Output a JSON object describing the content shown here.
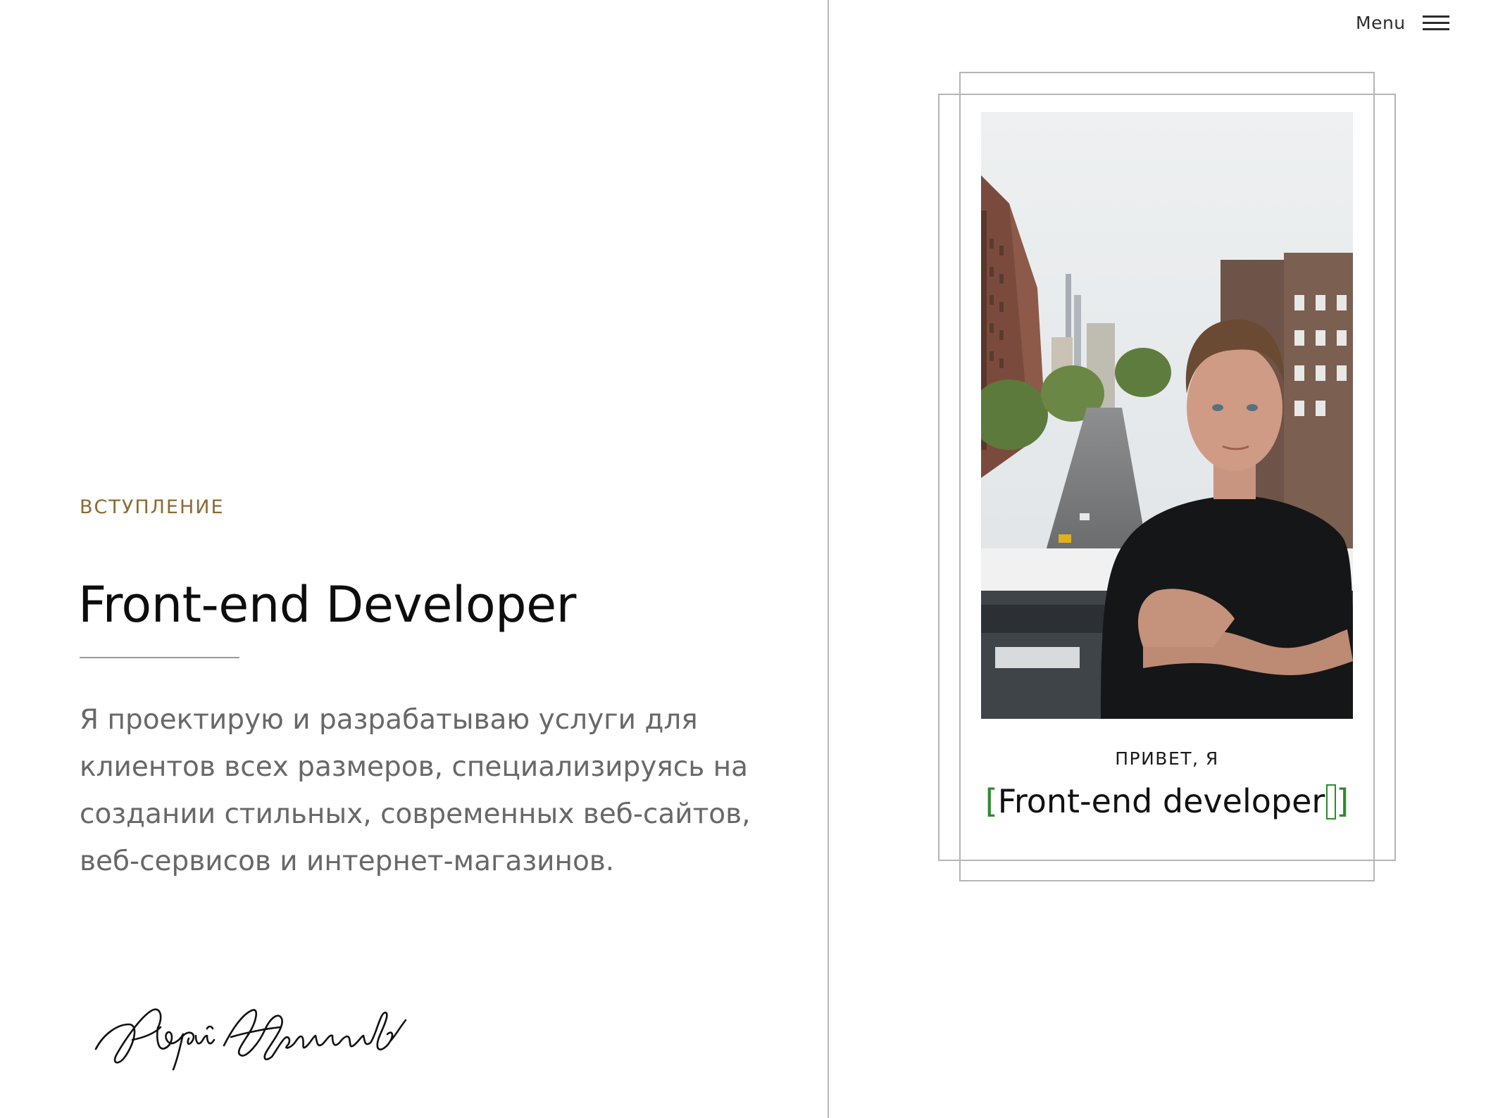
{
  "header": {
    "menu_label": "Menu"
  },
  "intro": {
    "eyebrow": "ВСТУПЛЕНИЕ",
    "title": "Front-end Developer",
    "description": "Я проектирую и разрабатываю услуги для клиентов всех размеров, специализируясь на создании стильных, современных веб-сайтов, веб-сервисов и интернет-магазинов.",
    "signature": "Юрий Хомшов"
  },
  "profile_card": {
    "greeting": "ПРИВЕТ, Я",
    "bracket_open": "[",
    "role": "Front-end developer",
    "bracket_close": "]"
  },
  "colors": {
    "accent_gold": "#8b6a35",
    "bracket_green": "#2e8b2e",
    "body_text": "#686868"
  },
  "icons": {
    "menu": "hamburger-icon"
  }
}
